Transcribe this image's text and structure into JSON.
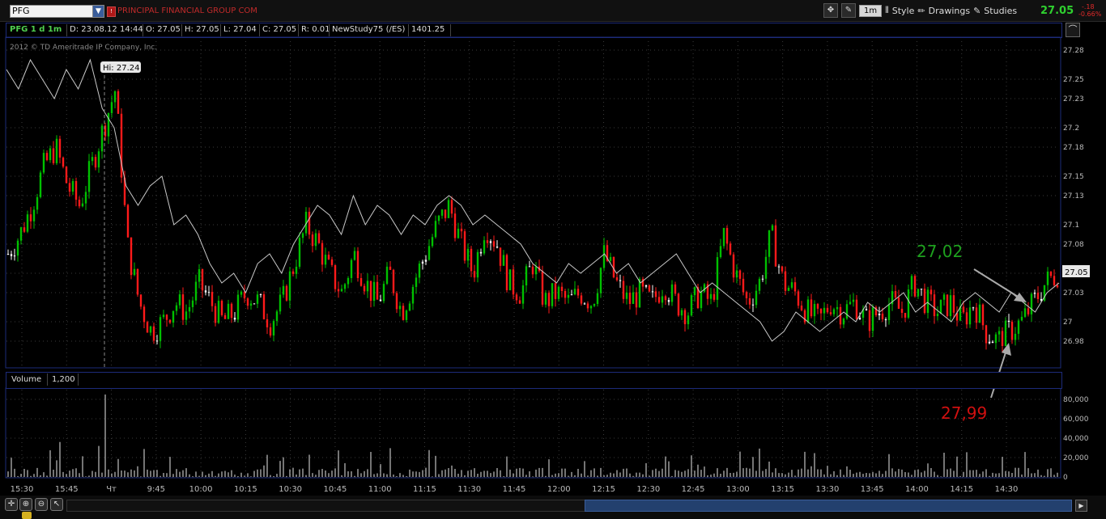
{
  "header": {
    "symbol": "PFG",
    "company_name": "PRINCIPAL FINANCIAL GROUP COM",
    "timeframe": "1m",
    "style_label": "Style",
    "drawings_label": "Drawings",
    "studies_label": "Studies",
    "last_price": "27.05",
    "net_change": "-.18",
    "pct_change": "-0.66%"
  },
  "info_bar": {
    "title": "PFG 1 d 1m",
    "date": "D: 23.08.12 14:44",
    "open": "O: 27.05",
    "high": "H: 27.05",
    "low": "L: 27.04",
    "close": "C: 27.05",
    "range": "R: 0.01",
    "study": "NewStudy75 (/ES)",
    "study_value": "1401.25"
  },
  "chart": {
    "copyright": "2012 © TD Ameritrade IP Company, Inc.",
    "hi_label": "Hi: 27.24",
    "current_price_label": "27.05",
    "annotation_green": "27,02",
    "annotation_red": "27,99",
    "colors": {
      "up": "#00c000",
      "down": "#ff1a1a",
      "line": "#c8c8c8",
      "grid": "#3a3a3a"
    }
  },
  "volume_bar": {
    "title": "Volume",
    "value": "1,200"
  },
  "chart_data": [
    {
      "type": "candlestick",
      "y_ticks": [
        "27.28",
        "27.25",
        "27.23",
        "27.2",
        "27.18",
        "27.15",
        "27.13",
        "27.1",
        "27.08",
        "27.05",
        "27.03",
        "27",
        "26.98"
      ],
      "ylim": [
        26.965,
        27.285
      ],
      "x_ticks": [
        "15:30",
        "15:45",
        "Чт",
        "9:45",
        "10:00",
        "10:15",
        "10:30",
        "10:45",
        "11:00",
        "11:15",
        "11:30",
        "11:45",
        "12:00",
        "12:15",
        "12:30",
        "12:45",
        "13:00",
        "13:15",
        "13:30",
        "13:45",
        "14:00",
        "14:15",
        "14:30"
      ],
      "price_path": [
        27.07,
        27.09,
        27.12,
        27.16,
        27.18,
        27.14,
        27.12,
        27.16,
        27.2,
        27.24,
        27.08,
        27.02,
        26.99,
        27.0,
        27.02,
        27.01,
        27.04,
        27.02,
        27.0,
        27.01,
        27.03,
        27.02,
        27.0,
        27.02,
        27.06,
        27.1,
        27.08,
        27.05,
        27.03,
        27.07,
        27.04,
        27.02,
        27.05,
        27.01,
        27.04,
        27.07,
        27.1,
        27.12,
        27.08,
        27.05,
        27.1,
        27.08,
        27.04,
        27.03,
        27.06,
        27.02,
        27.03,
        27.02,
        27.03,
        27.02,
        27.07,
        27.04,
        27.02,
        27.03,
        27.02,
        27.04,
        27.02,
        27.01,
        27.03,
        27.02,
        27.09,
        27.05,
        27.02,
        27.04,
        27.09,
        27.04,
        27.03,
        27.01,
        27.0,
        27.02,
        27.01,
        27.02,
        27.0,
        27.01,
        27.02,
        27.01,
        27.04,
        27.02,
        27.01,
        27.02,
        27.0,
        27.02,
        26.99,
        26.98,
        26.99,
        27.0,
        27.02,
        27.04,
        27.05
      ]
    },
    {
      "type": "line",
      "name": "NewStudy75 (/ES)",
      "values": [
        27.26,
        27.24,
        27.27,
        27.25,
        27.23,
        27.26,
        27.24,
        27.27,
        27.22,
        27.2,
        27.14,
        27.12,
        27.14,
        27.15,
        27.1,
        27.11,
        27.09,
        27.06,
        27.04,
        27.05,
        27.03,
        27.06,
        27.07,
        27.05,
        27.08,
        27.1,
        27.12,
        27.11,
        27.09,
        27.13,
        27.1,
        27.12,
        27.11,
        27.09,
        27.11,
        27.1,
        27.12,
        27.13,
        27.12,
        27.1,
        27.11,
        27.1,
        27.09,
        27.08,
        27.06,
        27.05,
        27.04,
        27.06,
        27.05,
        27.06,
        27.07,
        27.05,
        27.06,
        27.04,
        27.05,
        27.06,
        27.07,
        27.05,
        27.03,
        27.04,
        27.03,
        27.02,
        27.01,
        27.0,
        26.98,
        26.99,
        27.01,
        27.0,
        26.99,
        27.0,
        27.01,
        27.0,
        27.02,
        27.01,
        27.02,
        27.03,
        27.01,
        27.02,
        27.01,
        27.0,
        27.02,
        27.03,
        27.02,
        27.01,
        27.03,
        27.02,
        27.01,
        27.03,
        27.04
      ]
    },
    {
      "type": "bar",
      "name": "Volume",
      "y_ticks": [
        "80,000",
        "60,000",
        "40,000",
        "20,000",
        "0"
      ],
      "ylim": [
        0,
        90000
      ],
      "peak_volume": 85000
    }
  ]
}
